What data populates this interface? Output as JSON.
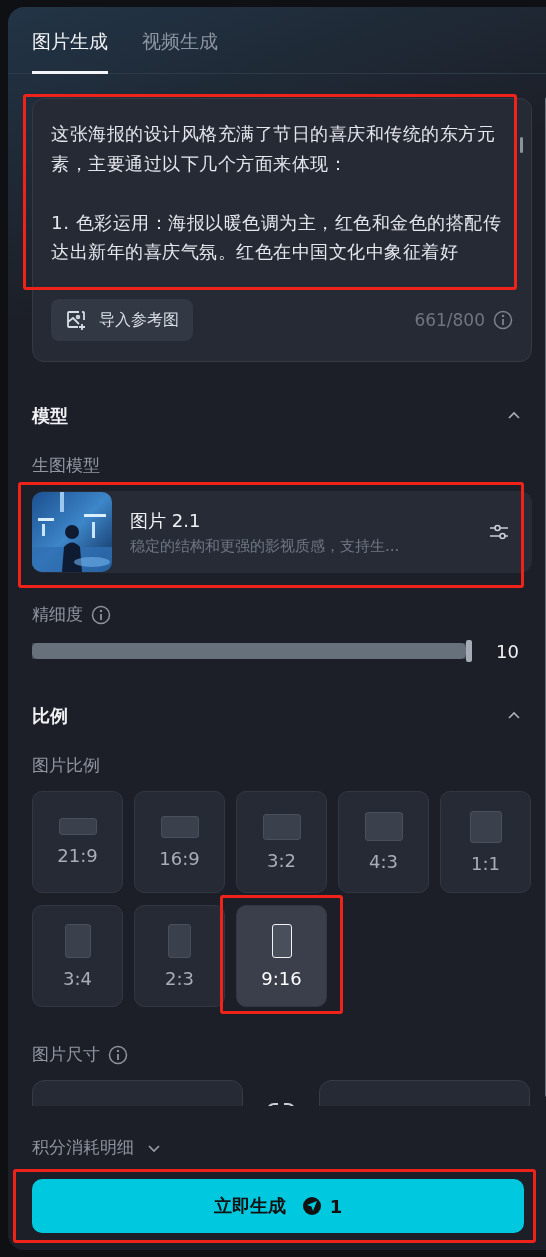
{
  "tabs": [
    {
      "label": "图片生成",
      "selected": true
    },
    {
      "label": "视频生成",
      "selected": false
    }
  ],
  "prompt": {
    "value": "这张海报的设计风格充满了节日的喜庆和传统的东方元素，主要通过以下几个方面来体现：\n\n1. 色彩运用：海报以暖色调为主，红色和金色的搭配传达出新年的喜庆气氛。红色在中国文化中象征着好",
    "highlighted": true,
    "import_button": "导入参考图",
    "counter": "661/800"
  },
  "model_section": {
    "title": "模型",
    "expanded": true,
    "label": "生图模型",
    "model": {
      "name": "图片 2.1",
      "description": "稳定的结构和更强的影视质感，支持生...",
      "highlighted": true
    }
  },
  "detail": {
    "label": "精细度",
    "level": 1,
    "reading": "10"
  },
  "ratio_section": {
    "title": "比例",
    "expanded": true,
    "label": "图片比例",
    "ratios": [
      {
        "label": "21:9",
        "selected": false,
        "highlighted": false
      },
      {
        "label": "16:9",
        "selected": false,
        "highlighted": false
      },
      {
        "label": "3:2",
        "selected": false,
        "highlighted": false
      },
      {
        "label": "4:3",
        "selected": false,
        "highlighted": false
      },
      {
        "label": "1:1",
        "selected": false,
        "highlighted": false
      },
      {
        "label": "3:4",
        "selected": false,
        "highlighted": false
      },
      {
        "label": "2:3",
        "selected": false,
        "highlighted": false
      },
      {
        "label": "9:16",
        "selected": true,
        "highlighted": true
      }
    ]
  },
  "size": {
    "label": "图片尺寸"
  },
  "footer": {
    "cost_details": {
      "label": "积分消耗明细",
      "expanded": false
    },
    "generate_button": {
      "label": "立即生成",
      "cost": "1",
      "highlighted": true
    }
  }
}
